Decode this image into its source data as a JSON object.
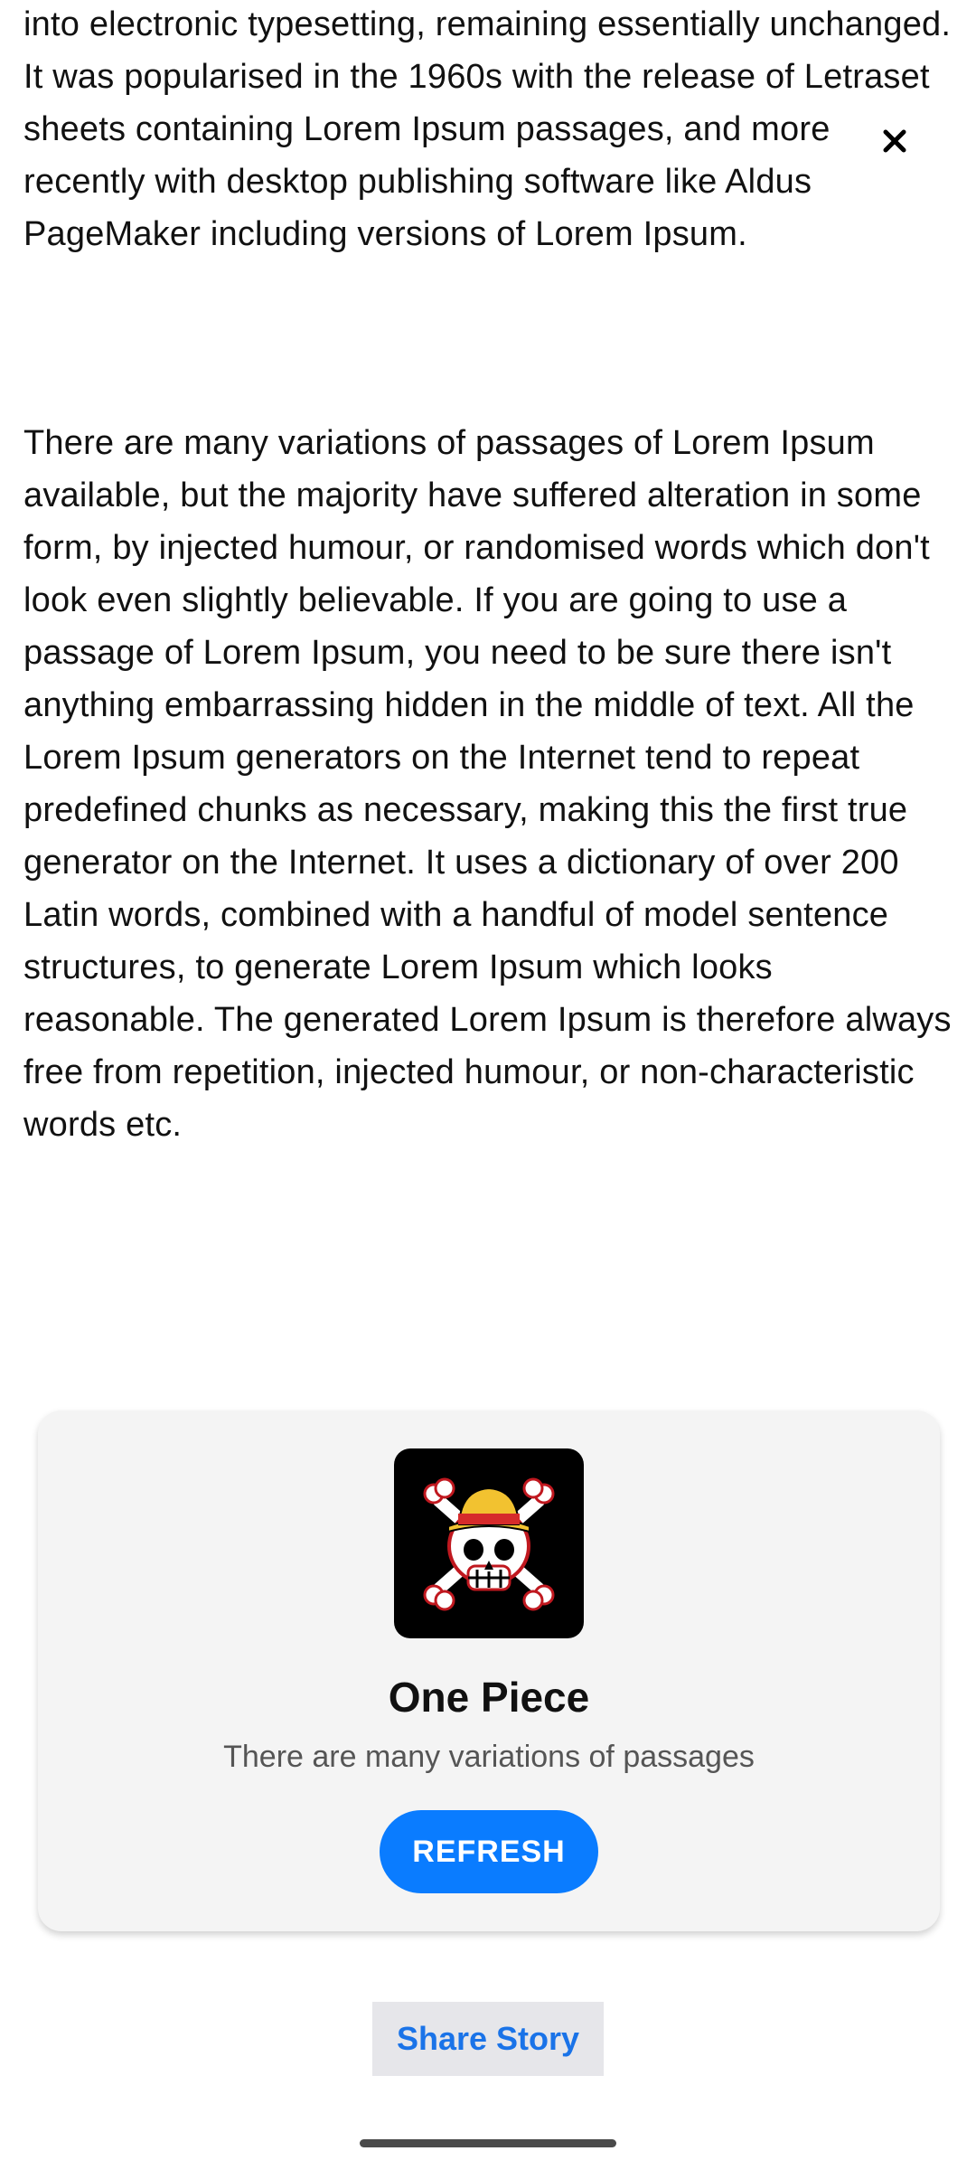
{
  "article": {
    "paragraph_1": "into electronic typesetting, remaining essentially unchanged. It was popularised in the 1960s with the release of Letraset sheets containing Lorem Ipsum passages, and more recently with desktop publishing software like Aldus PageMaker including versions of Lorem Ipsum.",
    "paragraph_2": "There are many variations of passages of Lorem Ipsum available, but the majority have suffered alteration in some form, by injected humour, or randomised words which don't look even slightly believable. If you are going to use a passage of Lorem Ipsum, you need to be sure there isn't anything embarrassing hidden in the middle of text. All the Lorem Ipsum generators on the Internet tend to repeat predefined chunks as necessary, making this the first true generator on the Internet. It uses a dictionary of over 200 Latin words, combined with a handful of model sentence structures, to generate Lorem Ipsum which looks reasonable. The generated Lorem Ipsum is therefore always free from repetition, injected humour, or non-characteristic words etc."
  },
  "overlay": {
    "close_icon": "close-icon"
  },
  "story_card": {
    "logo_icon": "straw-hat-jolly-roger-icon",
    "title": "One Piece",
    "subtitle": "There are many variations of passages",
    "refresh_label": "REFRESH"
  },
  "share": {
    "label": "Share Story"
  },
  "colors": {
    "accent": "#0a7cff",
    "link": "#1a73e8",
    "card_bg": "#f4f4f4",
    "share_bg": "#e6e6ea"
  }
}
